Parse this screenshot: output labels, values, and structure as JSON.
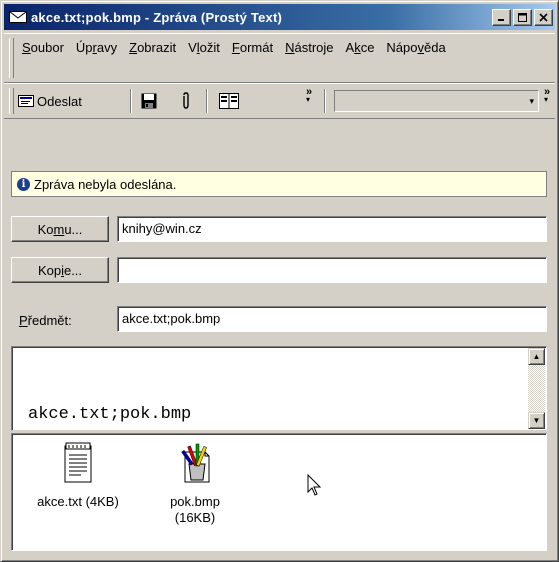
{
  "window": {
    "title": "akce.txt;pok.bmp - Zpráva (Prostý Text)",
    "icon": "mail-envelope-icon",
    "controls": {
      "minimize": "_",
      "maximize": "□",
      "close": "×"
    }
  },
  "menu": [
    {
      "label": "Soubor",
      "accel": "S"
    },
    {
      "label": "Úpravy",
      "accel": "r"
    },
    {
      "label": "Zobrazit",
      "accel": "Z"
    },
    {
      "label": "Vložit",
      "accel": "l"
    },
    {
      "label": "Formát",
      "accel": "F"
    },
    {
      "label": "Nástroje",
      "accel": "N"
    },
    {
      "label": "Akce",
      "accel": "k"
    },
    {
      "label": "Nápověda",
      "accel": "v"
    }
  ],
  "toolbar": {
    "send_label": "Odeslat",
    "send_icon": "send-message-icon",
    "save_icon": "floppy-disk-icon",
    "attach_icon": "paperclip-icon",
    "addressbook_icon": "address-book-icon",
    "overflow": "»",
    "dropdown_arrow": "▾"
  },
  "info": {
    "icon": "info-icon",
    "icon_glyph": "i",
    "message": "Zpráva nebyla odeslána."
  },
  "fields": {
    "to_button": "Komu...",
    "to_value": "knihy@win.cz",
    "cc_button": "Kopie...",
    "cc_value": "",
    "subject_label": "Předmět:",
    "subject_value": "akce.txt;pok.bmp"
  },
  "body": {
    "text": "akce.txt;pok.bmp"
  },
  "attachments": [
    {
      "name": "akce.txt (4KB)",
      "icon": "text-document-icon"
    },
    {
      "name": "pok.bmp (16KB)",
      "icon": "paint-bitmap-icon"
    }
  ],
  "colors": {
    "titlebar_start": "#0a246a",
    "titlebar_end": "#a6caf0",
    "info_background": "#ffffe1",
    "window_face": "#d4d0c8"
  }
}
